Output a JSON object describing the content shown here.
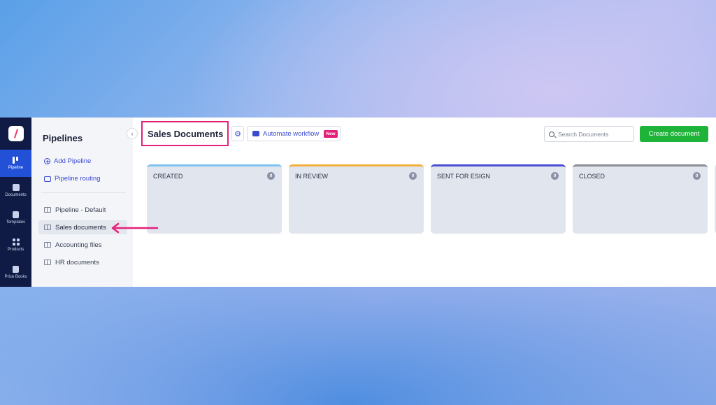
{
  "rail": {
    "items": [
      {
        "label": "Pipeline",
        "icon": "pipeline-icon",
        "active": true
      },
      {
        "label": "Documents",
        "icon": "documents-icon"
      },
      {
        "label": "Templates",
        "icon": "templates-icon"
      },
      {
        "label": "Products",
        "icon": "products-icon"
      },
      {
        "label": "Price Books",
        "icon": "price-books-icon"
      }
    ]
  },
  "panel": {
    "title": "Pipelines",
    "add_pipeline": "Add Pipeline",
    "pipeline_routing": "Pipeline routing",
    "pipelines": [
      {
        "label": "Pipeline - Default"
      },
      {
        "label": "Sales documents",
        "selected": true
      },
      {
        "label": "Accounting files"
      },
      {
        "label": "HR documents"
      }
    ]
  },
  "header": {
    "title": "Sales Documents",
    "automate_label": "Automate workflow",
    "new_badge": "New",
    "search_placeholder": "Search Documents",
    "create_label": "Create document"
  },
  "columns": [
    {
      "name": "CREATED",
      "count": "0",
      "color": "#7ec3ef"
    },
    {
      "name": "IN REVIEW",
      "count": "0",
      "color": "#f3b03e"
    },
    {
      "name": "SENT FOR ESIGN",
      "count": "0",
      "color": "#4b4fd1"
    },
    {
      "name": "CLOSED",
      "count": "0",
      "color": "#8c8f96"
    }
  ],
  "colors": {
    "accent": "#2251d8",
    "highlight": "#e2207a",
    "create": "#1eb339",
    "rail_bg": "#0f1b45"
  }
}
